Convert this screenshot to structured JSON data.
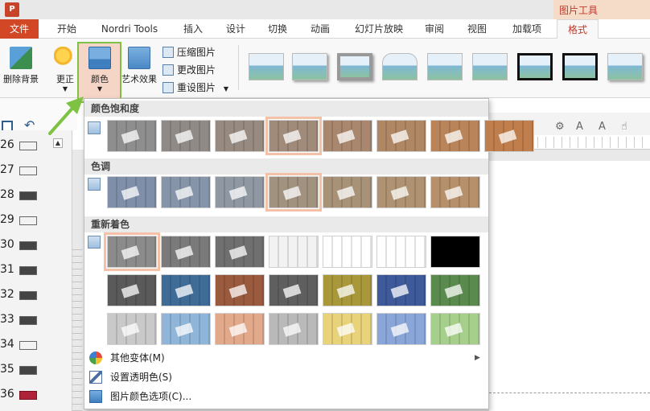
{
  "titlebar": {
    "app_icon": "P",
    "context_label": "图片工具"
  },
  "tabs": [
    "文件",
    "开始",
    "Nordri Tools",
    "插入",
    "设计",
    "切换",
    "动画",
    "幻灯片放映",
    "审阅",
    "视图",
    "加载项",
    "格式"
  ],
  "ribbon": {
    "remove_background": "删除背景",
    "corrections": "更正",
    "color": "颜色",
    "artistic_effects": "艺术效果",
    "compress": "压缩图片",
    "change": "更改图片",
    "reset": "重设图片"
  },
  "slide_numbers": [
    "26",
    "27",
    "28",
    "29",
    "30",
    "31",
    "32",
    "33",
    "34",
    "35",
    "36"
  ],
  "dropdown": {
    "saturation_header": "颜色饱和度",
    "tone_header": "色调",
    "recolor_header": "重新着色",
    "more_variations": "其他变体(M)",
    "set_transparent": "设置透明色(S)",
    "picture_color_options": "图片颜色选项(C)..."
  },
  "swatches": {
    "saturation": [
      "#8e8e8e",
      "#8f8a86",
      "#978a80",
      "#a08a7a",
      "#a8876e",
      "#b08764",
      "#b9845a",
      "#c07e4c"
    ],
    "tone": [
      "#7f8faa",
      "#8594a8",
      "#8e97a2",
      "#a0927f",
      "#a89277",
      "#ae9272",
      "#b5906a"
    ],
    "recolor": [
      [
        "#8b8b8b",
        "#7a7a7a",
        "#6f6f6f",
        "#f2f2f2",
        "#ffffff",
        "#ffffff",
        "#000000"
      ],
      [
        "#5a5a5a",
        "#3f6c97",
        "#9a5a3d",
        "#5f5f5f",
        "#a8983a",
        "#3e5a9a",
        "#5a8a4e"
      ],
      [
        "#c9c9c9",
        "#8fb5d8",
        "#e2a98a",
        "#b9b9b9",
        "#e8d27a",
        "#8aa6d8",
        "#a6cf8c"
      ]
    ]
  }
}
